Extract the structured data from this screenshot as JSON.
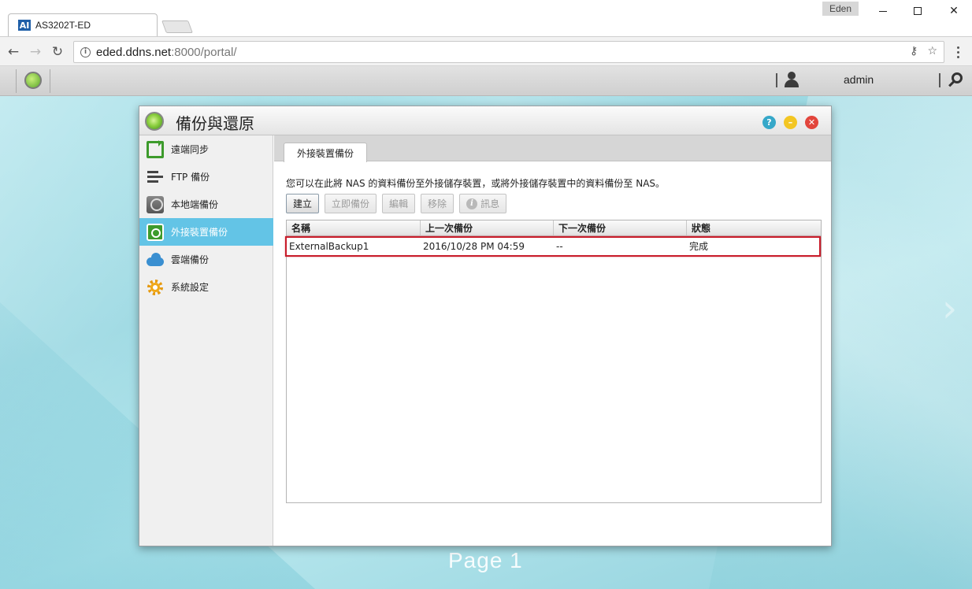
{
  "browser": {
    "tab_title": "AS3202T-ED",
    "tab_favicon": "AI",
    "profile": "Eden",
    "url_host": "eded.ddns.net",
    "url_rest": ":8000/portal/"
  },
  "adm": {
    "user": "admin"
  },
  "window": {
    "title": "備份與還原"
  },
  "sidebar": {
    "items": [
      {
        "label": "遠端同步",
        "icon": "remote-sync-icon"
      },
      {
        "label": "FTP 備份",
        "icon": "ftp-backup-icon"
      },
      {
        "label": "本地端備份",
        "icon": "local-backup-icon"
      },
      {
        "label": "外接裝置備份",
        "icon": "external-backup-icon"
      },
      {
        "label": "雲端備份",
        "icon": "cloud-backup-icon"
      },
      {
        "label": "系統設定",
        "icon": "gear-icon"
      }
    ],
    "active_index": 3
  },
  "content": {
    "tab": "外接裝置備份",
    "description": "您可以在此將 NAS 的資料備份至外接儲存裝置，或將外接儲存裝置中的資料備份至 NAS。",
    "buttons": {
      "create": "建立",
      "backup_now": "立即備份",
      "edit": "編輯",
      "remove": "移除",
      "info": "訊息"
    },
    "table": {
      "columns": [
        "名稱",
        "上一次備份",
        "下一次備份",
        "狀態"
      ],
      "rows": [
        [
          "ExternalBackup1",
          "2016/10/28 PM 04:59",
          "--",
          "完成"
        ]
      ]
    }
  },
  "page_label": "Page 1",
  "colors": {
    "active_sidebar": "#63c4e6",
    "highlight": "#c81c2a"
  }
}
